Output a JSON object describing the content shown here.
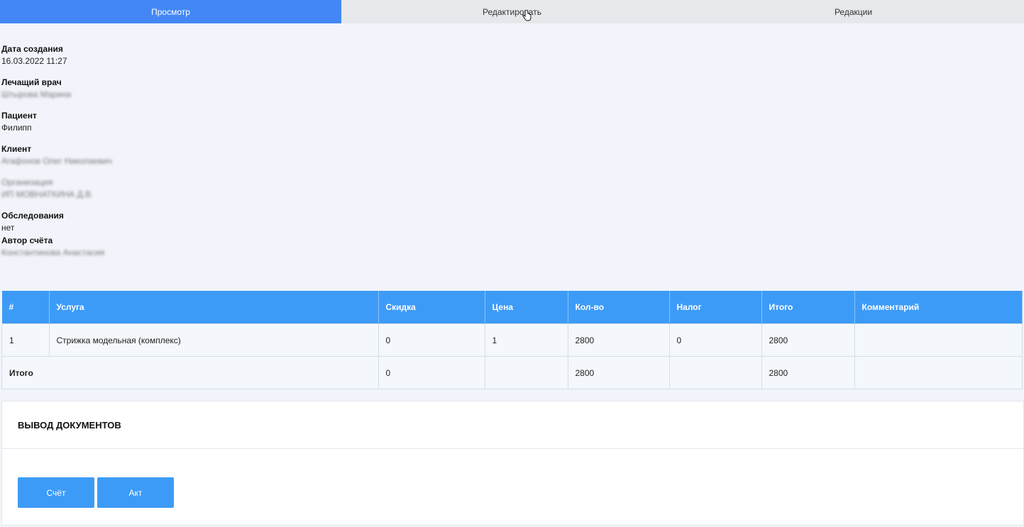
{
  "tabs": [
    {
      "label": "Просмотр",
      "active": true
    },
    {
      "label": "Редактировать",
      "active": false
    },
    {
      "label": "Редакции",
      "active": false
    }
  ],
  "fields": {
    "created": {
      "label": "Дата создания",
      "value": "16.03.2022 11:27"
    },
    "doctor": {
      "label": "Лечащий врач",
      "value": "Штырова Марина"
    },
    "patient": {
      "label": "Пациент",
      "value": "Филипп"
    },
    "client": {
      "label": "Клиент",
      "value": "Агафонов Олег Николаевич"
    },
    "organization": {
      "label": "Организация",
      "value": "ИП МОВНАТКИНА Д.В."
    },
    "examinations": {
      "label": "Обследования",
      "value": "нет"
    },
    "author": {
      "label": "Автор счёта",
      "value": "Константинова Анастасия"
    }
  },
  "table": {
    "headers": [
      "#",
      "Услуга",
      "Скидка",
      "Цена",
      "Кол-во",
      "Налог",
      "Итого",
      "Комментарий"
    ],
    "rows": [
      [
        "1",
        "Стрижка модельная (комплекс)",
        "0",
        "1",
        "2800",
        "0",
        "2800",
        ""
      ]
    ],
    "total": {
      "label": "Итого",
      "discount": "0",
      "price": "",
      "qty": "2800",
      "tax": "",
      "sum": "2800",
      "comment": ""
    }
  },
  "documents": {
    "title": "ВЫВОД ДОКУМЕНТОВ",
    "buttons": [
      "Счёт",
      "Акт"
    ]
  },
  "colors": {
    "accent": "#3d9bf8",
    "tab_active": "#4287f5",
    "background": "#f1f5fb"
  }
}
